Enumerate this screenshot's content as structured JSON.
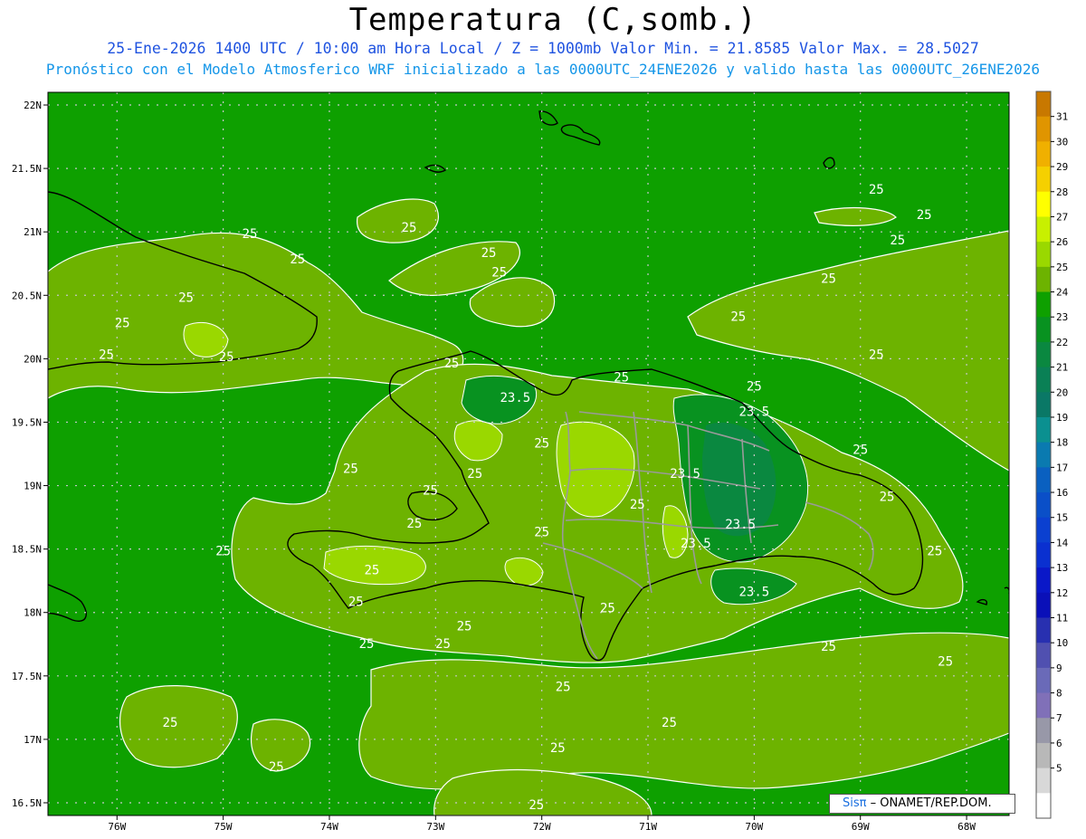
{
  "title": "Temperatura (C,somb.)",
  "subtitle_line1": "25-Ene-2026 1400 UTC / 10:00 am Hora Local / Z = 1000mb  Valor Min. = 21.8585  Valor Max. = 28.5027",
  "subtitle_line2": "Pronóstico con el Modelo Atmosferico WRF inicializado a las 0000UTC_24ENE2026 y valido hasta las  0000UTC_26ENE2026",
  "lat_labels": [
    "22N",
    "21.5N",
    "21N",
    "20.5N",
    "20N",
    "19.5N",
    "19N",
    "18.5N",
    "18N",
    "17.5N",
    "17N",
    "16.5N"
  ],
  "lon_labels": [
    "76W",
    "75W",
    "74W",
    "73W",
    "72W",
    "71W",
    "70W",
    "69W",
    "68W"
  ],
  "colorbar_labels": [
    "31",
    "30",
    "29",
    "28",
    "27",
    "26",
    "25",
    "24",
    "23",
    "22",
    "21",
    "20",
    "19",
    "18",
    "17",
    "16",
    "15",
    "14",
    "13",
    "12",
    "11",
    "10",
    "9",
    "8",
    "7",
    "6",
    "5"
  ],
  "colorbar_colors": [
    "#c87800",
    "#e09500",
    "#f0b000",
    "#f5d000",
    "#ffff00",
    "#c8f000",
    "#9ad800",
    "#6db300",
    "#0ea000",
    "#089220",
    "#0a8840",
    "#0a8055",
    "#0a7866",
    "#0b9090",
    "#0a7ab0",
    "#0a60c0",
    "#0a4fc8",
    "#0b40d0",
    "#0a30d0",
    "#0a18c8",
    "#0a10b8",
    "#2830b0",
    "#5050b0",
    "#6a6ab8",
    "#8070b8",
    "#9898a8",
    "#b8b8b8",
    "#d8d8d8",
    "#ffffff"
  ],
  "contour_labels": [
    {
      "text": "25",
      "lon": -74.75,
      "lat": 20.95
    },
    {
      "text": "25",
      "lon": -74.3,
      "lat": 20.75
    },
    {
      "text": "25",
      "lon": -75.35,
      "lat": 20.45
    },
    {
      "text": "25",
      "lon": -75.95,
      "lat": 20.25
    },
    {
      "text": "25",
      "lon": -76.1,
      "lat": 20.0
    },
    {
      "text": "25",
      "lon": -74.97,
      "lat": 19.98
    },
    {
      "text": "25",
      "lon": -73.25,
      "lat": 21.0
    },
    {
      "text": "25",
      "lon": -72.5,
      "lat": 20.8
    },
    {
      "text": "25",
      "lon": -72.4,
      "lat": 20.65
    },
    {
      "text": "25",
      "lon": -72.85,
      "lat": 19.93
    },
    {
      "text": "23.5",
      "lon": -72.25,
      "lat": 19.66
    },
    {
      "text": "25",
      "lon": -72.0,
      "lat": 19.3
    },
    {
      "text": "25",
      "lon": -71.25,
      "lat": 19.82
    },
    {
      "text": "25",
      "lon": -70.0,
      "lat": 19.75
    },
    {
      "text": "23.5",
      "lon": -70.0,
      "lat": 19.55
    },
    {
      "text": "25",
      "lon": -69.0,
      "lat": 19.25
    },
    {
      "text": "23.5",
      "lon": -70.65,
      "lat": 19.06
    },
    {
      "text": "25",
      "lon": -73.8,
      "lat": 19.1
    },
    {
      "text": "25",
      "lon": -72.63,
      "lat": 19.06
    },
    {
      "text": "25",
      "lon": -73.05,
      "lat": 18.93
    },
    {
      "text": "25",
      "lon": -73.2,
      "lat": 18.67
    },
    {
      "text": "25",
      "lon": -71.1,
      "lat": 18.82
    },
    {
      "text": "25",
      "lon": -72.0,
      "lat": 18.6
    },
    {
      "text": "23.5",
      "lon": -70.13,
      "lat": 18.66
    },
    {
      "text": "23.5",
      "lon": -70.55,
      "lat": 18.51
    },
    {
      "text": "25",
      "lon": -68.75,
      "lat": 18.88
    },
    {
      "text": "25",
      "lon": -75.0,
      "lat": 18.45
    },
    {
      "text": "25",
      "lon": -73.6,
      "lat": 18.3
    },
    {
      "text": "23.5",
      "lon": -70.0,
      "lat": 18.13
    },
    {
      "text": "25",
      "lon": -68.3,
      "lat": 18.45
    },
    {
      "text": "25",
      "lon": -73.75,
      "lat": 18.05
    },
    {
      "text": "25",
      "lon": -71.38,
      "lat": 18.0
    },
    {
      "text": "25",
      "lon": -72.73,
      "lat": 17.86
    },
    {
      "text": "25",
      "lon": -73.65,
      "lat": 17.72
    },
    {
      "text": "25",
      "lon": -72.93,
      "lat": 17.72
    },
    {
      "text": "25",
      "lon": -69.3,
      "lat": 17.7
    },
    {
      "text": "25",
      "lon": -68.2,
      "lat": 17.58
    },
    {
      "text": "25",
      "lon": -71.8,
      "lat": 17.38
    },
    {
      "text": "25",
      "lon": -75.5,
      "lat": 17.1
    },
    {
      "text": "25",
      "lon": -70.8,
      "lat": 17.1
    },
    {
      "text": "25",
      "lon": -71.85,
      "lat": 16.9
    },
    {
      "text": "25",
      "lon": -74.5,
      "lat": 16.75
    },
    {
      "text": "25",
      "lon": -72.05,
      "lat": 16.45
    },
    {
      "text": "25",
      "lon": -68.85,
      "lat": 21.3
    },
    {
      "text": "25",
      "lon": -68.4,
      "lat": 21.1
    },
    {
      "text": "25",
      "lon": -68.65,
      "lat": 20.9
    },
    {
      "text": "25",
      "lon": -69.3,
      "lat": 20.6
    },
    {
      "text": "25",
      "lon": -70.15,
      "lat": 20.3
    },
    {
      "text": "25",
      "lon": -68.85,
      "lat": 20.0
    }
  ],
  "credit": {
    "brand": "Sisπ",
    "rest": " – ONAMET/REP.DOM."
  }
}
